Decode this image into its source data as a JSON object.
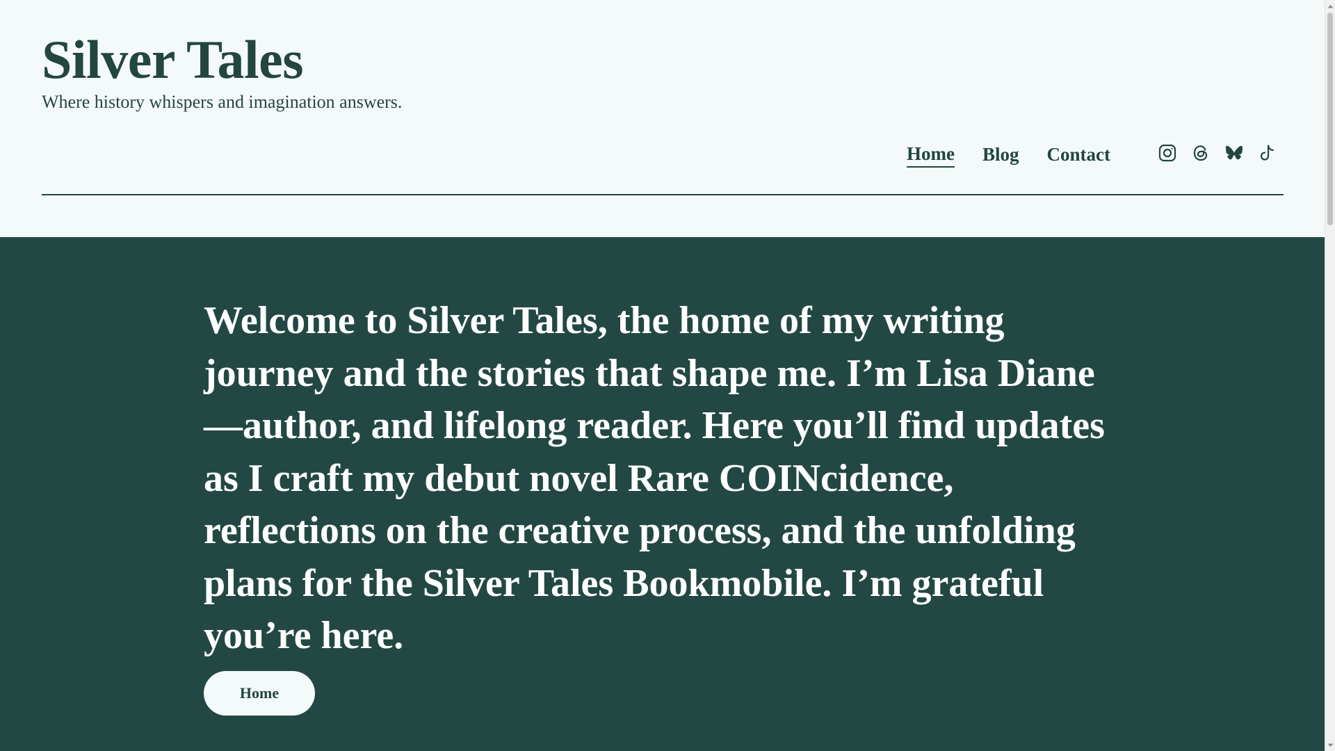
{
  "site": {
    "title": "Silver Tales",
    "tagline": "Where history whispers and imagination answers."
  },
  "nav": {
    "items": [
      {
        "label": "Home",
        "active": true
      },
      {
        "label": "Blog",
        "active": false
      },
      {
        "label": "Contact",
        "active": false
      }
    ]
  },
  "social": {
    "icons": [
      "instagram-icon",
      "threads-icon",
      "bluesky-icon",
      "tiktok-icon"
    ]
  },
  "hero": {
    "text": "Welcome to Silver Tales, the home of my writing journey and the stories that shape me. I’m Lisa Diane—author, and lifelong reader. Here you’ll find updates as I craft my debut novel Rare COINcidence, reflections on the creative process, and the unfolding plans for the Silver Tales Bookmobile. I’m grateful you’re here.",
    "button_label": "Home"
  },
  "colors": {
    "brand": "#23463f",
    "hero_bg": "#234843",
    "page_bg": "#f4faf9",
    "hero_text": "#ffffff"
  }
}
